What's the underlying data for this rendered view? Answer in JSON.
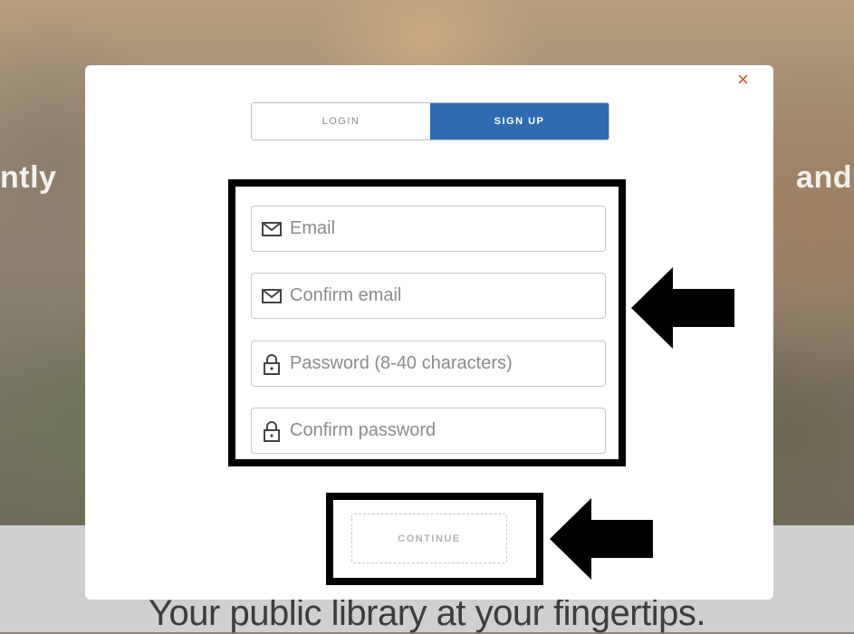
{
  "background": {
    "left_text": "ntly",
    "right_text": "and",
    "tagline": "Your public library at your fingertips."
  },
  "modal": {
    "close_icon": "×",
    "tabs": [
      {
        "label": "LOGIN",
        "active": false
      },
      {
        "label": "SIGN UP",
        "active": true
      }
    ],
    "fields": [
      {
        "placeholder": "Email",
        "value": "",
        "icon": "envelope-icon"
      },
      {
        "placeholder": "Confirm email",
        "value": "",
        "icon": "envelope-icon"
      },
      {
        "placeholder": "Password (8-40 characters)",
        "value": "",
        "icon": "lock-icon"
      },
      {
        "placeholder": "Confirm password",
        "value": "",
        "icon": "lock-icon"
      }
    ],
    "continue_label": "CONTINUE"
  },
  "colors": {
    "accent": "#2f6bb0",
    "close": "#d4531c",
    "annotation": "#000000"
  }
}
